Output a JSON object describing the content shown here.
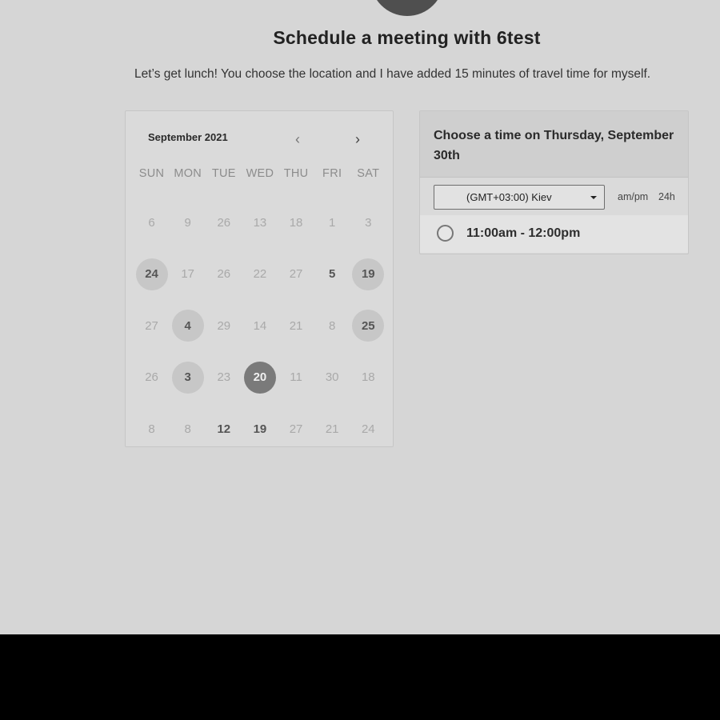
{
  "header": {
    "title": "Schedule a meeting with 6test",
    "description": "Let’s get lunch! You choose the location and I have added 15 minutes of travel time for myself."
  },
  "calendar": {
    "month_label": "September 2021",
    "prev_icon": "chevron-left-icon",
    "next_icon": "chevron-right-icon",
    "weekdays": [
      "SUN",
      "MON",
      "TUE",
      "WED",
      "THU",
      "FRI",
      "SAT"
    ],
    "weeks": [
      [
        {
          "d": "6"
        },
        {
          "d": "9"
        },
        {
          "d": "26"
        },
        {
          "d": "13"
        },
        {
          "d": "18"
        },
        {
          "d": "1"
        },
        {
          "d": "3"
        }
      ],
      [
        {
          "d": "24",
          "s": "avail"
        },
        {
          "d": "17"
        },
        {
          "d": "26"
        },
        {
          "d": "22"
        },
        {
          "d": "27"
        },
        {
          "d": "5",
          "s": "bold"
        },
        {
          "d": "19",
          "s": "avail"
        }
      ],
      [
        {
          "d": "27"
        },
        {
          "d": "4",
          "s": "avail"
        },
        {
          "d": "29"
        },
        {
          "d": "14"
        },
        {
          "d": "21"
        },
        {
          "d": "8"
        },
        {
          "d": "25",
          "s": "avail"
        }
      ],
      [
        {
          "d": "26"
        },
        {
          "d": "3",
          "s": "avail"
        },
        {
          "d": "23"
        },
        {
          "d": "20",
          "s": "selected"
        },
        {
          "d": "11"
        },
        {
          "d": "30"
        },
        {
          "d": "18"
        }
      ],
      [
        {
          "d": "8"
        },
        {
          "d": "8"
        },
        {
          "d": "12",
          "s": "bold"
        },
        {
          "d": "19",
          "s": "bold"
        },
        {
          "d": "27"
        },
        {
          "d": "21"
        },
        {
          "d": "24"
        }
      ]
    ]
  },
  "time_panel": {
    "heading": "Choose a time on Thursday, September 30th",
    "timezone": "(GMT+03:00) Kiev",
    "format_ampm": "am/pm",
    "format_24h": "24h",
    "slots": [
      "11:00am - 12:00pm"
    ]
  },
  "colors": {
    "page_bg": "#d6d6d6",
    "selected_day": "#7a7a7a",
    "available_day": "#c7c7c7"
  }
}
